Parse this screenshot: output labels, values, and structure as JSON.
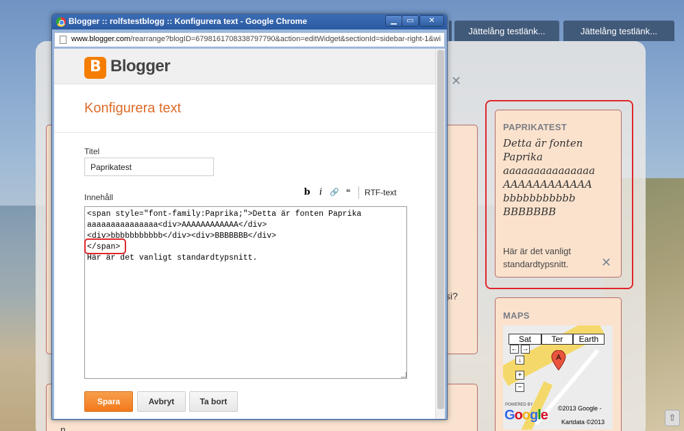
{
  "window": {
    "title": "Blogger :: rolfstestblogg :: Konfigurera text - Google Chrome",
    "min_label": "▁",
    "max_label": "▭",
    "close_label": "✕"
  },
  "urlbar": {
    "host": "www.blogger.com",
    "path": "/rearrange?blogID=6798161708338797790&action=editWidget&sectionId=sidebar-right-1&wi"
  },
  "blogger": {
    "name": "Blogger",
    "page_title": "Konfigurera text",
    "title_label": "Titel",
    "title_value": "Paprikatest",
    "content_label": "Innehåll",
    "toolbar": {
      "bold": "b",
      "italic": "i",
      "link": "🔗",
      "quote": "❝",
      "rtf": "RTF-text"
    },
    "editor_lines": [
      "<span style=\"font-family:Paprika;\">Detta är fonten Paprika",
      "aaaaaaaaaaaaaaa<div>AAAAAAAAAAAA</div>",
      "<div>bbbbbbbbbbb</div><div>BBBBBBB</div>",
      "</span>",
      "Här är det vanligt standardtypsnitt."
    ],
    "buttons": {
      "save": "Spara",
      "cancel": "Avbryt",
      "delete": "Ta bort"
    }
  },
  "blog": {
    "tabs": [
      "Jättelång testlänk...",
      "Jättelång testlänk..."
    ],
    "post_fragment_si": "si?",
    "post_fragment_n": "n",
    "widgets": {
      "paprika": {
        "title": "PAPRIKATEST",
        "lines": [
          "Detta är fonten",
          "Paprika",
          "aaaaaaaaaaaaaaa",
          "AAAAAAAAAAAA",
          "bbbbbbbbbbb",
          "BBBBBBB"
        ],
        "normal": "Här är det vanligt standardtypsnitt."
      },
      "maps": {
        "title": "MAPS",
        "tabs": [
          "Sat",
          "Ter",
          "Earth"
        ],
        "marker": "A",
        "powered": "POWERED BY",
        "google": "Google",
        "copyright": "©2013 Google -",
        "kartdata": "Kartdata ©2013"
      }
    }
  },
  "colors": {
    "accent": "#f3791a",
    "highlight": "#e0242a",
    "title_orange": "#dd6a27"
  }
}
